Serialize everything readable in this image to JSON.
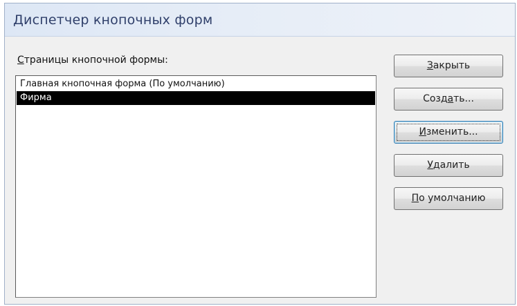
{
  "window": {
    "title": "Диспетчер кнопочных форм"
  },
  "list": {
    "label_accel": "С",
    "label_rest": "траницы кнопочной формы:",
    "items": [
      {
        "text": "Главная кнопочная форма (По умолчанию)",
        "selected": false
      },
      {
        "text": "Фирма",
        "selected": true
      }
    ]
  },
  "buttons": {
    "close": {
      "pre": "",
      "accel": "З",
      "post": "акрыть"
    },
    "create": {
      "pre": "Созд",
      "accel": "а",
      "post": "ть..."
    },
    "edit": {
      "pre": "",
      "accel": "И",
      "post": "зменить..."
    },
    "delete": {
      "pre": "",
      "accel": "У",
      "post": "далить"
    },
    "default": {
      "pre": "",
      "accel": "П",
      "post": "о умолчанию"
    }
  }
}
